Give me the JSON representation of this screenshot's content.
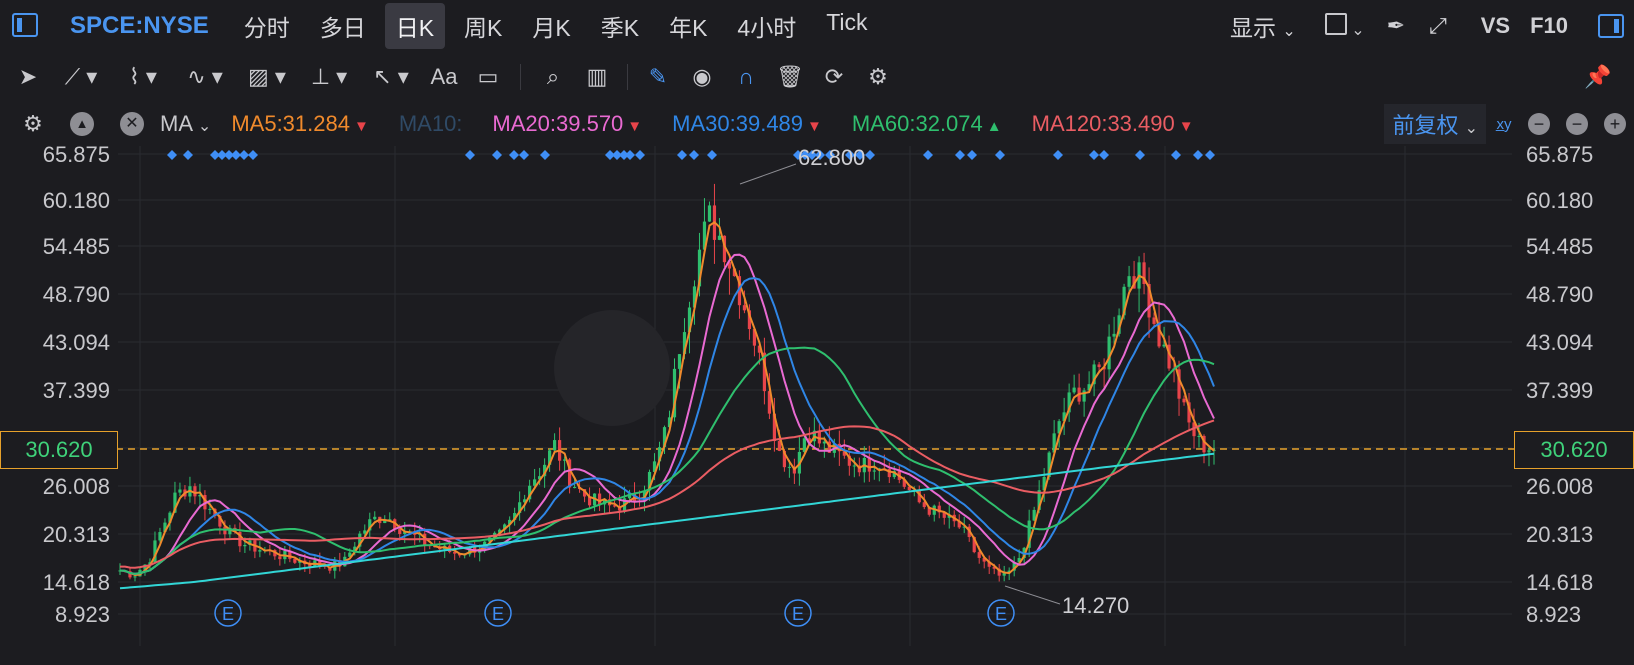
{
  "header": {
    "ticker": "SPCE:NYSE",
    "tabs": [
      "分时",
      "多日",
      "日K",
      "周K",
      "月K",
      "季K",
      "年K",
      "4小时",
      "Tick"
    ],
    "active_tab": "日K",
    "display_label": "显示",
    "vs_label": "VS",
    "f10_label": "F10"
  },
  "indicator_bar": {
    "ma_label": "MA",
    "items": [
      {
        "label": "MA5:31.284",
        "color": "#f08a2c",
        "arrow": "▼",
        "arrow_color": "#e8444a"
      },
      {
        "label": "MA10:",
        "color": "#2f4a66",
        "arrow": "",
        "arrow_color": ""
      },
      {
        "label": "MA20:39.570",
        "color": "#e96ad2",
        "arrow": "▼",
        "arrow_color": "#e8444a"
      },
      {
        "label": "MA30:39.489",
        "color": "#2f86e6",
        "arrow": "▼",
        "arrow_color": "#e8444a"
      },
      {
        "label": "MA60:32.074",
        "color": "#2fbf6e",
        "arrow": "▲",
        "arrow_color": "#2fbf6e"
      },
      {
        "label": "MA120:33.490",
        "color": "#ea5d63",
        "arrow": "▼",
        "arrow_color": "#e8444a"
      }
    ],
    "adjust_label": "前复权"
  },
  "chart_data": {
    "type": "candlestick",
    "y_ticks": [
      "65.875",
      "60.180",
      "54.485",
      "48.790",
      "43.094",
      "37.399",
      "30.620",
      "26.008",
      "20.313",
      "14.618",
      "8.923"
    ],
    "ylim": [
      8.923,
      65.875
    ],
    "current_price": "30.620",
    "high_annotation": "62.800",
    "low_annotation": "14.270",
    "earnings_marker": "E",
    "earnings_count": 4,
    "price_path": [
      16,
      15.5,
      17,
      21,
      25,
      26,
      24,
      22,
      20,
      19,
      18.5,
      18,
      17.5,
      17,
      16.8,
      16.5,
      17,
      20,
      22,
      22.5,
      21,
      20,
      19,
      18.5,
      18,
      18.5,
      19,
      20,
      22,
      26,
      28,
      31,
      27,
      25,
      24,
      23.5,
      24,
      25,
      28,
      33,
      44,
      52,
      58,
      55,
      50,
      45,
      38,
      30,
      28,
      33,
      31,
      30,
      29,
      28.5,
      29,
      28,
      26,
      24,
      23,
      22,
      21,
      18,
      16,
      15,
      17,
      22,
      28,
      34,
      37,
      38,
      40,
      46,
      52,
      50,
      44,
      40,
      34,
      31,
      30.6
    ],
    "series": [
      {
        "name": "MA5",
        "color": "#f08a2c"
      },
      {
        "name": "MA20",
        "color": "#e96ad2"
      },
      {
        "name": "MA30",
        "color": "#2f86e6"
      },
      {
        "name": "MA60",
        "color": "#2fbf6e"
      },
      {
        "name": "MA120",
        "color": "#ea5d63"
      },
      {
        "name": "MA250",
        "color": "#32d6d6"
      }
    ],
    "up_color": "#2fbf6e",
    "down_color": "#e8444a"
  }
}
